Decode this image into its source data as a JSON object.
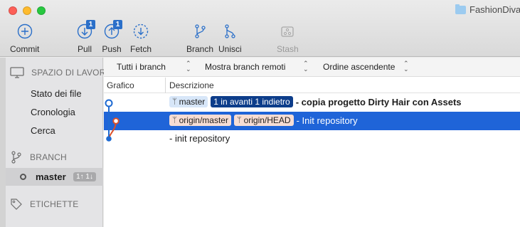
{
  "window": {
    "title": "FashionDiva"
  },
  "toolbar": {
    "commit": {
      "label": "Commit"
    },
    "pull": {
      "label": "Pull",
      "badge": "1"
    },
    "push": {
      "label": "Push",
      "badge": "1"
    },
    "fetch": {
      "label": "Fetch"
    },
    "branch": {
      "label": "Branch"
    },
    "merge": {
      "label": "Unisci"
    },
    "stash": {
      "label": "Stash"
    }
  },
  "sidebar": {
    "workspace": {
      "title": "SPAZIO DI LAVORO",
      "items": [
        "Stato dei file",
        "Cronologia",
        "Cerca"
      ]
    },
    "branch": {
      "title": "BRANCH",
      "current": "master",
      "ahead_behind": "1↑ 1↓"
    },
    "tags": {
      "title": "ETICHETTE"
    }
  },
  "filters": {
    "branches": "Tutti i branch",
    "remotes": "Mostra branch remoti",
    "order": "Ordine ascendente"
  },
  "columns": {
    "graph": "Grafico",
    "description": "Descrizione"
  },
  "commits": [
    {
      "refs": [
        "master"
      ],
      "status": "1 in avanti 1 indietro",
      "message": "- copia progetto Dirty Hair con Assets"
    },
    {
      "refs": [
        "origin/master",
        "origin/HEAD"
      ],
      "message": "- Init repository"
    },
    {
      "message": "- init repository"
    }
  ],
  "colors": {
    "accent": "#1f64d8",
    "graph_blue": "#1e6ad2",
    "graph_orange": "#d94f2a"
  }
}
